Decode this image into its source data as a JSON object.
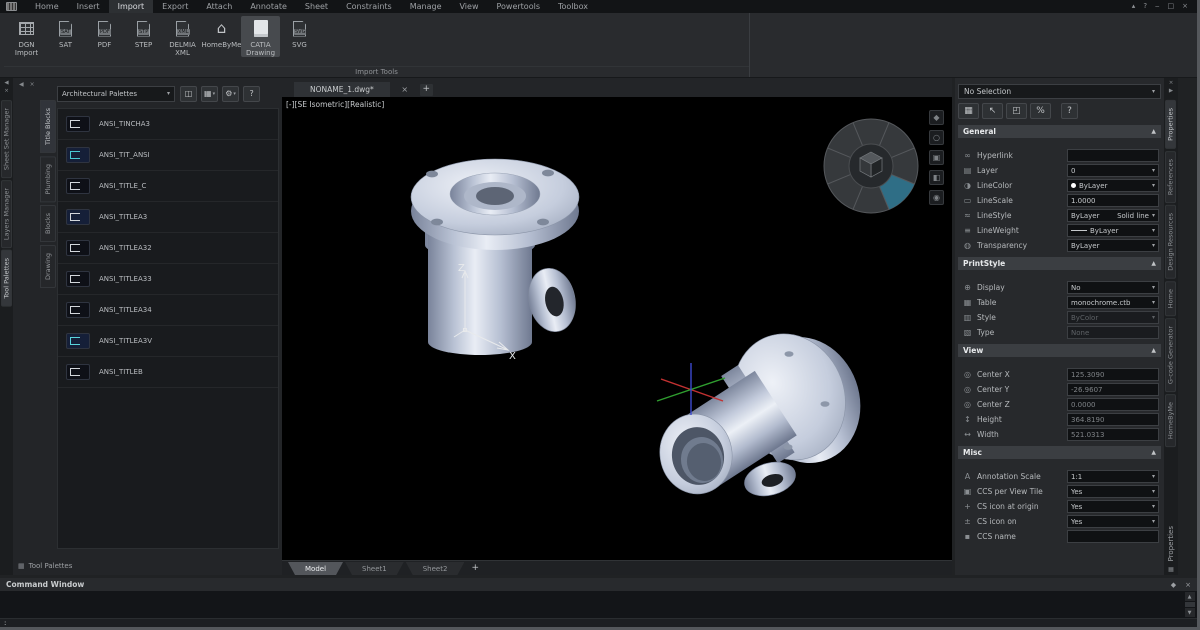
{
  "colors": {
    "viewport_bg": "#000000",
    "lookfrom_highlight": "#2f6e86",
    "model_steel": "#c7cfdf",
    "panel_bg": "#27292c"
  },
  "titlebar": {
    "menu_tabs": [
      "Home",
      "Insert",
      "Import",
      "Export",
      "Attach",
      "Annotate",
      "Sheet",
      "Constraints",
      "Manage",
      "View",
      "Powertools",
      "Toolbox"
    ],
    "active_tab": "Import",
    "window_controls": [
      "collapse-ribbon",
      "help",
      "minimize",
      "maximize",
      "close"
    ]
  },
  "ribbon": {
    "group_label": "Import Tools",
    "active_tool": "CATIA Drawing",
    "tools": [
      {
        "label": "DGN\nImport",
        "icon": "dgn-grid-icon"
      },
      {
        "label": "SAT",
        "icon": "file-icon",
        "tag": "SAT"
      },
      {
        "label": "PDF",
        "icon": "file-icon",
        "tag": "PDF"
      },
      {
        "label": "STEP",
        "icon": "file-icon",
        "tag": "STP"
      },
      {
        "label": "DELMIA\nXML",
        "icon": "file-icon",
        "tag": "XML"
      },
      {
        "label": "HomeByMe",
        "icon": "house-icon"
      },
      {
        "label": "CATIA\nDrawing",
        "icon": "document-icon"
      },
      {
        "label": "SVG",
        "icon": "file-icon",
        "tag": "SVG"
      }
    ]
  },
  "left_dock": {
    "tabs": [
      "Sheet Set Manager",
      "Layers Manager",
      "Tool Palettes"
    ],
    "active_tab": "Tool Palettes"
  },
  "palette_panel": {
    "palette_dropdown": "Architectural Palettes",
    "toolbar": [
      {
        "icon": "save-icon",
        "caret": false
      },
      {
        "icon": "view-options-icon",
        "caret": true
      },
      {
        "icon": "settings-gear-icon",
        "caret": true
      },
      {
        "icon": "help-icon",
        "caret": false
      }
    ],
    "categories": [
      "Title Blocks",
      "Plumbing",
      "Blocks",
      "Drawing"
    ],
    "active_category": "Title Blocks",
    "items": [
      "ANSI_TINCHA3",
      "ANSI_TIT_ANSI",
      "ANSI_TITLE_C",
      "ANSI_TITLEA3",
      "ANSI_TITLEA32",
      "ANSI_TITLEA33",
      "ANSI_TITLEA34",
      "ANSI_TITLEA3V",
      "ANSI_TITLEB"
    ],
    "caption": "Tool Palettes"
  },
  "document": {
    "tab": "NONAME_1.dwg*",
    "viewport_controls": "[-][SE Isometric][Realistic]",
    "layout_tabs": [
      "Model",
      "Sheet1",
      "Sheet2"
    ],
    "active_layout_tab": "Model",
    "ucs_labels": {
      "z": "Z",
      "x": "X"
    },
    "viewport_widget_buttons": [
      "diamond-icon",
      "circle-icon",
      "square-filled-icon",
      "square-half-icon",
      "target-icon"
    ]
  },
  "properties_panel": {
    "selection_dropdown": "No Selection",
    "toolbar": [
      "quick-select-icon",
      "select-cursor-icon",
      "select-window-icon",
      "pick-filter-icon",
      "help-icon"
    ],
    "sections": [
      {
        "title": "General",
        "rows": [
          {
            "icon": "hyperlink-icon",
            "label": "Hyperlink",
            "value": "",
            "control": "field"
          },
          {
            "icon": "layer-icon",
            "label": "Layer",
            "value": "0",
            "control": "dropdown"
          },
          {
            "icon": "line-color-icon",
            "label": "LineColor",
            "value": "ByLayer",
            "control": "dropdown",
            "swatch": "#ffffff"
          },
          {
            "icon": "line-scale-icon",
            "label": "LineScale",
            "value": "1.0000",
            "control": "field"
          },
          {
            "icon": "line-style-icon",
            "label": "LineStyle",
            "value": "ByLayer",
            "value2": "Solid line",
            "control": "dropdown"
          },
          {
            "icon": "line-weight-icon",
            "label": "LineWeight",
            "value": "ByLayer",
            "control": "dropdown",
            "weight_sample": true
          },
          {
            "icon": "transparency-icon",
            "label": "Transparency",
            "value": "ByLayer",
            "control": "dropdown"
          }
        ]
      },
      {
        "title": "PrintStyle",
        "rows": [
          {
            "icon": "display-icon",
            "label": "Display",
            "value": "No",
            "control": "dropdown"
          },
          {
            "icon": "table-icon",
            "label": "Table",
            "value": "monochrome.ctb",
            "control": "dropdown"
          },
          {
            "icon": "style-icon",
            "label": "Style",
            "value": "ByColor",
            "control": "disabled-dropdown"
          },
          {
            "icon": "type-icon",
            "label": "Type",
            "value": "None",
            "control": "disabled-field"
          }
        ]
      },
      {
        "title": "View",
        "rows": [
          {
            "icon": "center-x-icon",
            "label": "Center X",
            "value": "125.3090",
            "control": "readonly"
          },
          {
            "icon": "center-y-icon",
            "label": "Center Y",
            "value": "-26.9607",
            "control": "readonly"
          },
          {
            "icon": "center-z-icon",
            "label": "Center Z",
            "value": "0.0000",
            "control": "readonly"
          },
          {
            "icon": "height-icon",
            "label": "Height",
            "value": "364.8190",
            "control": "readonly"
          },
          {
            "icon": "width-icon",
            "label": "Width",
            "value": "521.0313",
            "control": "readonly"
          }
        ]
      },
      {
        "title": "Misc",
        "rows": [
          {
            "icon": "annotation-scale-icon",
            "label": "Annotation Scale",
            "value": "1:1",
            "control": "dropdown"
          },
          {
            "icon": "ccs-view-tile-icon",
            "label": "CCS per View Tile",
            "value": "Yes",
            "control": "dropdown"
          },
          {
            "icon": "cs-origin-icon",
            "label": "CS icon at origin",
            "value": "Yes",
            "control": "dropdown"
          },
          {
            "icon": "cs-on-icon",
            "label": "CS icon on",
            "value": "Yes",
            "control": "dropdown"
          },
          {
            "icon": "ccs-name-icon",
            "label": "CCS name",
            "value": "",
            "control": "field"
          }
        ]
      }
    ]
  },
  "right_dock": {
    "tabs": [
      "Properties",
      "References",
      "Design Resources",
      "Home",
      "G-code Generator",
      "HomeByMe"
    ],
    "active_tab": "Properties",
    "caption": "Properties"
  },
  "command_window": {
    "title": "Command Window",
    "prompt": ":"
  }
}
